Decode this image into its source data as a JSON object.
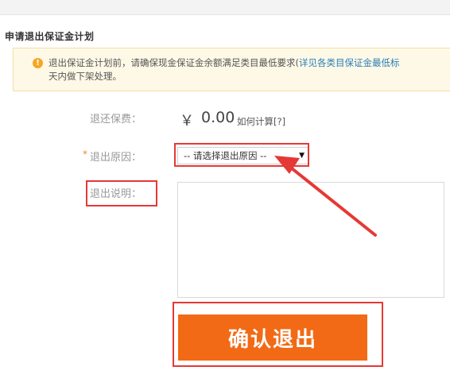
{
  "page": {
    "title": "申请退出保证金计划"
  },
  "notice": {
    "icon": "info-icon",
    "line1_text": "退出保证金计划前，请确保现金保证金余额满足类目最低要求(",
    "line1_link": "详见各类目保证金最低标",
    "line2_text": "天内做下架处理。"
  },
  "form": {
    "refund_label": "退还保费：",
    "currency": "￥",
    "amount": "0.00",
    "how_link": "如何计算[?]",
    "reason_required_mark": "*",
    "reason_label": "退出原因：",
    "reason_selected": "-- 请选择退出原因 --",
    "reason_arrow": "▼",
    "note_label": "退出说明：",
    "note_value": ""
  },
  "actions": {
    "confirm_label": "确认退出"
  },
  "colors": {
    "accent": "#f26a15",
    "annotation": "#e53935",
    "link": "#2a7fb8",
    "notice_bg": "#fef9e6"
  }
}
